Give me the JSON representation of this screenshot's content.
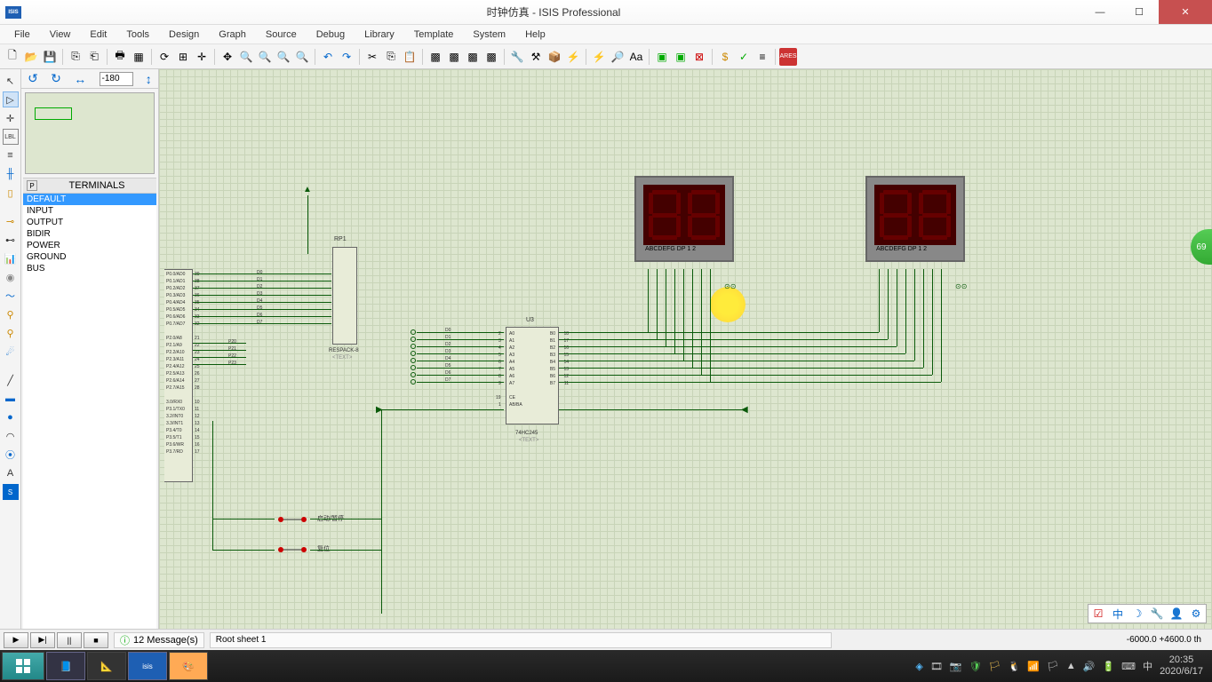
{
  "title": "时钟仿真 - ISIS Professional",
  "menus": [
    "File",
    "View",
    "Edit",
    "Tools",
    "Design",
    "Graph",
    "Source",
    "Debug",
    "Library",
    "Template",
    "System",
    "Help"
  ],
  "rotation": "-180",
  "palette": {
    "header": "TERMINALS",
    "p": "P",
    "items": [
      "DEFAULT",
      "INPUT",
      "OUTPUT",
      "BIDIR",
      "POWER",
      "GROUND",
      "BUS"
    ],
    "selected": 0
  },
  "components": {
    "rp1": {
      "name": "RP1",
      "sub": "RESPACK-8",
      "text": "<TEXT>"
    },
    "u3": {
      "name": "U3",
      "sub": "74HC245",
      "text": "<TEXT>",
      "pinsL": [
        "A0",
        "A1",
        "A2",
        "A3",
        "A4",
        "A5",
        "A6",
        "A7"
      ],
      "pinsR": [
        "B0",
        "B1",
        "B2",
        "B3",
        "B4",
        "B5",
        "B6",
        "B7"
      ],
      "ce": "CE",
      "ab": "AB/BA"
    },
    "seg_label": "ABCDEFG  DP      1 2",
    "btn1": "启动/暂停",
    "btn2": "复位"
  },
  "mcuL": {
    "p0": [
      "P0.0/AD0",
      "P0.1/AD1",
      "P0.2/AD2",
      "P0.3/AD3",
      "P0.4/AD4",
      "P0.5/AD5",
      "P0.6/AD6",
      "P0.7/AD7"
    ],
    "p0n": [
      "39",
      "38",
      "37",
      "36",
      "35",
      "34",
      "33",
      "32"
    ],
    "p2": [
      "P2.0/A8",
      "P2.1/A9",
      "P2.2/A10",
      "P2.3/A11",
      "P2.4/A12",
      "P2.5/A13",
      "P2.6/A14",
      "P2.7/A15"
    ],
    "p2n": [
      "21",
      "22",
      "23",
      "24",
      "25",
      "26",
      "27",
      "28"
    ],
    "p3": [
      "3.0/RX0",
      "P3.1/TX0",
      "3.2/INT0",
      "3.3/INT1",
      "P3.4/T0",
      "P3.5/T1",
      "P3.6/WR",
      "P3.7/RD"
    ],
    "p3n": [
      "10",
      "11",
      "12",
      "13",
      "14",
      "15",
      "16",
      "17"
    ]
  },
  "buslabels": {
    "d": [
      "D0",
      "D1",
      "D2",
      "D3",
      "D4",
      "D5",
      "D6",
      "D7"
    ],
    "p2": [
      "P20",
      "P21",
      "P22",
      "P23"
    ]
  },
  "messages": {
    "count": "12 Message(s)"
  },
  "sheet": "Root sheet 1",
  "coords": "-6000.0   +4600.0   th",
  "clock": {
    "time": "20:35",
    "date": "2020/6/17"
  },
  "badge": "69"
}
